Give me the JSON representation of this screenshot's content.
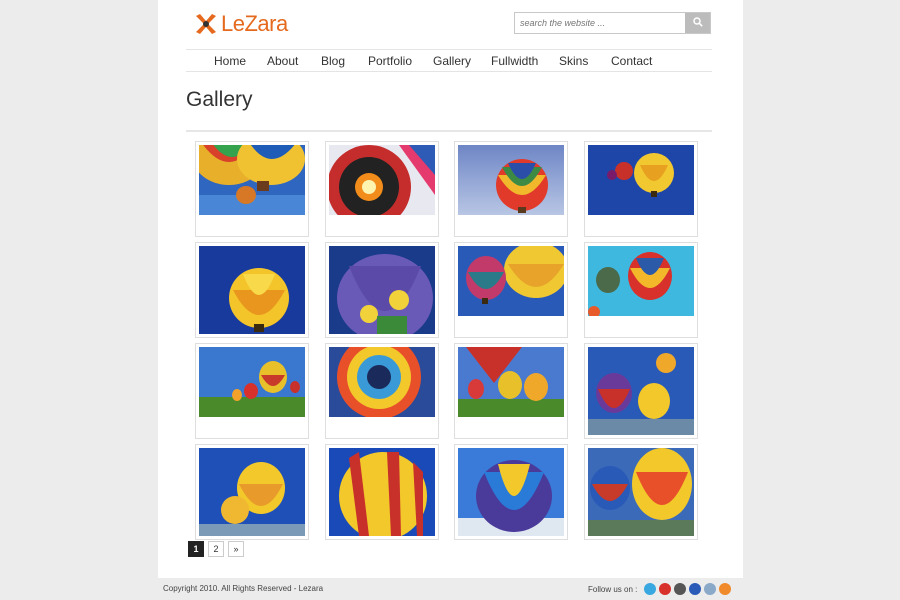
{
  "header": {
    "logo_text": "LeZara",
    "search": {
      "placeholder": "search the website ..."
    }
  },
  "nav": {
    "items": [
      {
        "label": "Home"
      },
      {
        "label": "About"
      },
      {
        "label": "Blog"
      },
      {
        "label": "Portfolio"
      },
      {
        "label": "Gallery"
      },
      {
        "label": "Fullwidth"
      },
      {
        "label": "Skins"
      },
      {
        "label": "Contact"
      }
    ]
  },
  "main": {
    "title": "Gallery",
    "pagination": [
      "1",
      "2",
      "»"
    ],
    "current_page": "1"
  },
  "footer": {
    "copyright": "Copyright 2010. All Rights Reserved - Lezara",
    "follow_label": "Follow us on :",
    "social_icons": [
      "twitter-icon",
      "youtube-icon",
      "digg-icon",
      "flickr-icon",
      "delicious-icon",
      "rss-icon"
    ]
  },
  "colors": {
    "brand": "#e56a1e",
    "page_bg": "#ececec",
    "text": "#333333",
    "sky": "#2e5aa8"
  }
}
